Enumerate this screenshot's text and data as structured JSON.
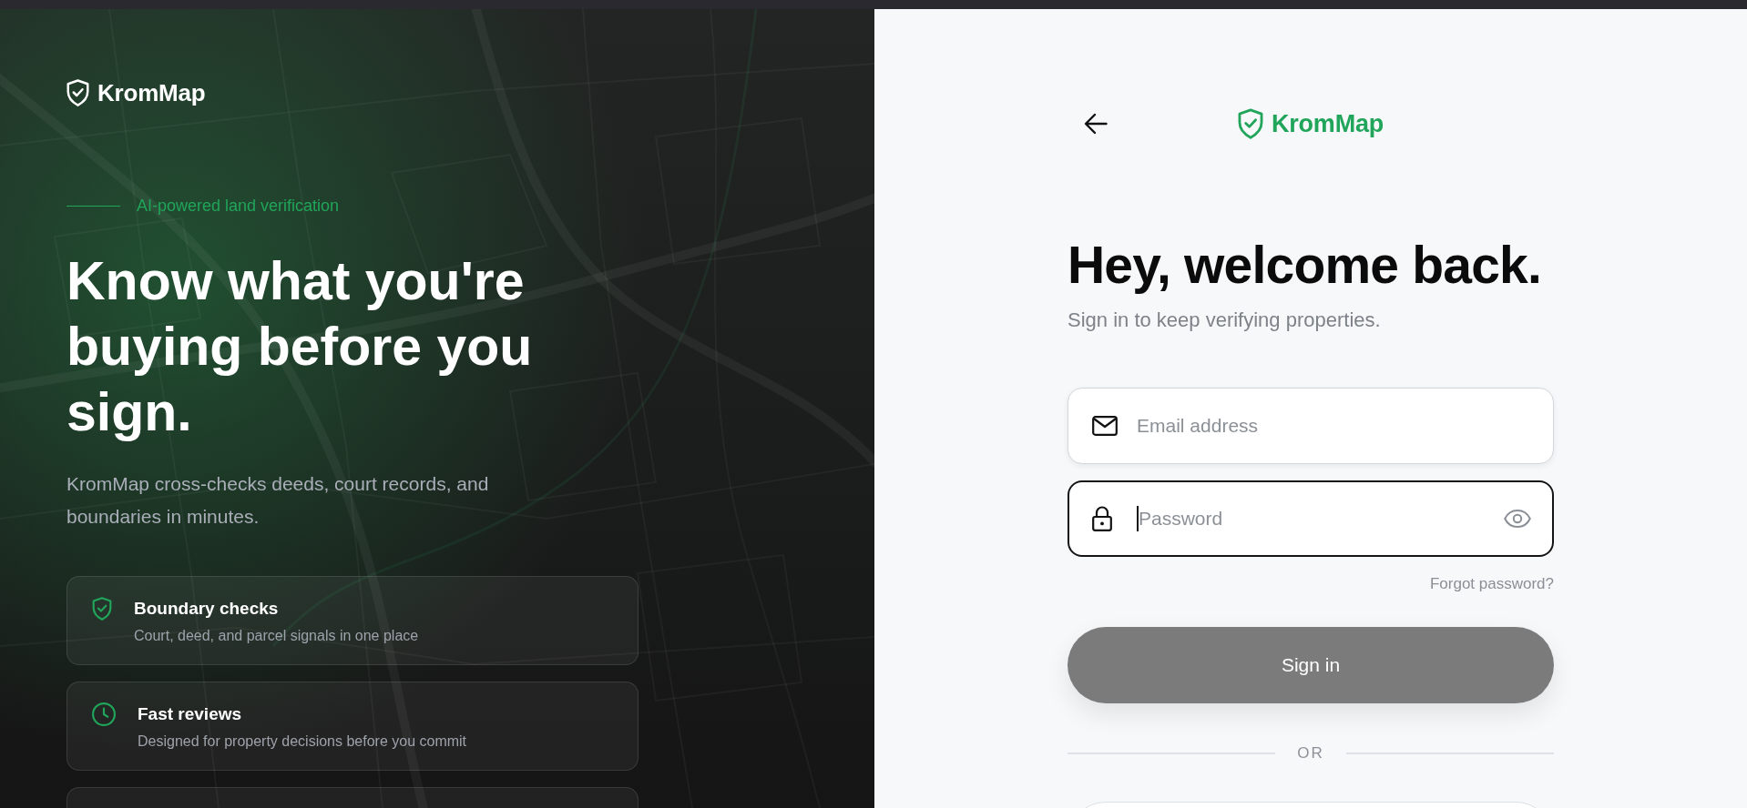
{
  "brand": {
    "name": "KromMap"
  },
  "hero": {
    "tagline": "AI-powered land verification",
    "headline": "Know what you're buying before you sign.",
    "description": "KromMap cross-checks deeds, court records, and boundaries in minutes.",
    "features": [
      {
        "kind": "shield",
        "title": "Boundary checks",
        "subtitle": "Court, deed, and parcel signals in one place"
      },
      {
        "kind": "clock",
        "title": "Fast reviews",
        "subtitle": "Designed for property decisions before you commit"
      }
    ],
    "more_features_below": true
  },
  "login": {
    "brand": "KromMap",
    "title": "Hey, welcome back.",
    "subtitle": "Sign in to keep verifying properties.",
    "fields": [
      {
        "kind": "email",
        "placeholder": "Email address",
        "focused": false
      },
      {
        "kind": "password",
        "placeholder": "Password",
        "focused": true,
        "reveal_toggle": true
      }
    ],
    "forgot_link": "Forgot password?",
    "submit": {
      "label": "Sign in",
      "disabled": true
    },
    "divider_label": "OR",
    "more_options_below": true
  }
}
